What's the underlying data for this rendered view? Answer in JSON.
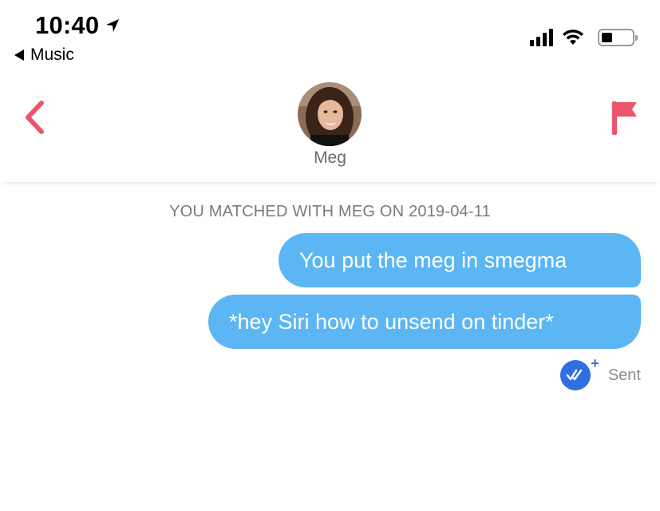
{
  "status_bar": {
    "time": "10:40",
    "back_app": "Music"
  },
  "header": {
    "match_name": "Meg"
  },
  "chat": {
    "match_banner": "YOU MATCHED WITH MEG ON 2019-04-11",
    "messages": [
      {
        "text": "You put the meg in smegma",
        "sender": "me"
      },
      {
        "text": "*hey Siri how to unsend on tinder*",
        "sender": "me"
      }
    ],
    "status": "Sent"
  },
  "colors": {
    "accent": "#e9566b",
    "bubble": "#5cb6f4",
    "receipt_badge": "#2f6fe0"
  },
  "icons": {
    "back": "chevron-left-icon",
    "report": "flag-icon",
    "location": "location-arrow-icon",
    "wifi": "wifi-icon",
    "signal": "cellular-signal-icon",
    "battery": "battery-icon",
    "read_receipt": "double-check-icon"
  }
}
